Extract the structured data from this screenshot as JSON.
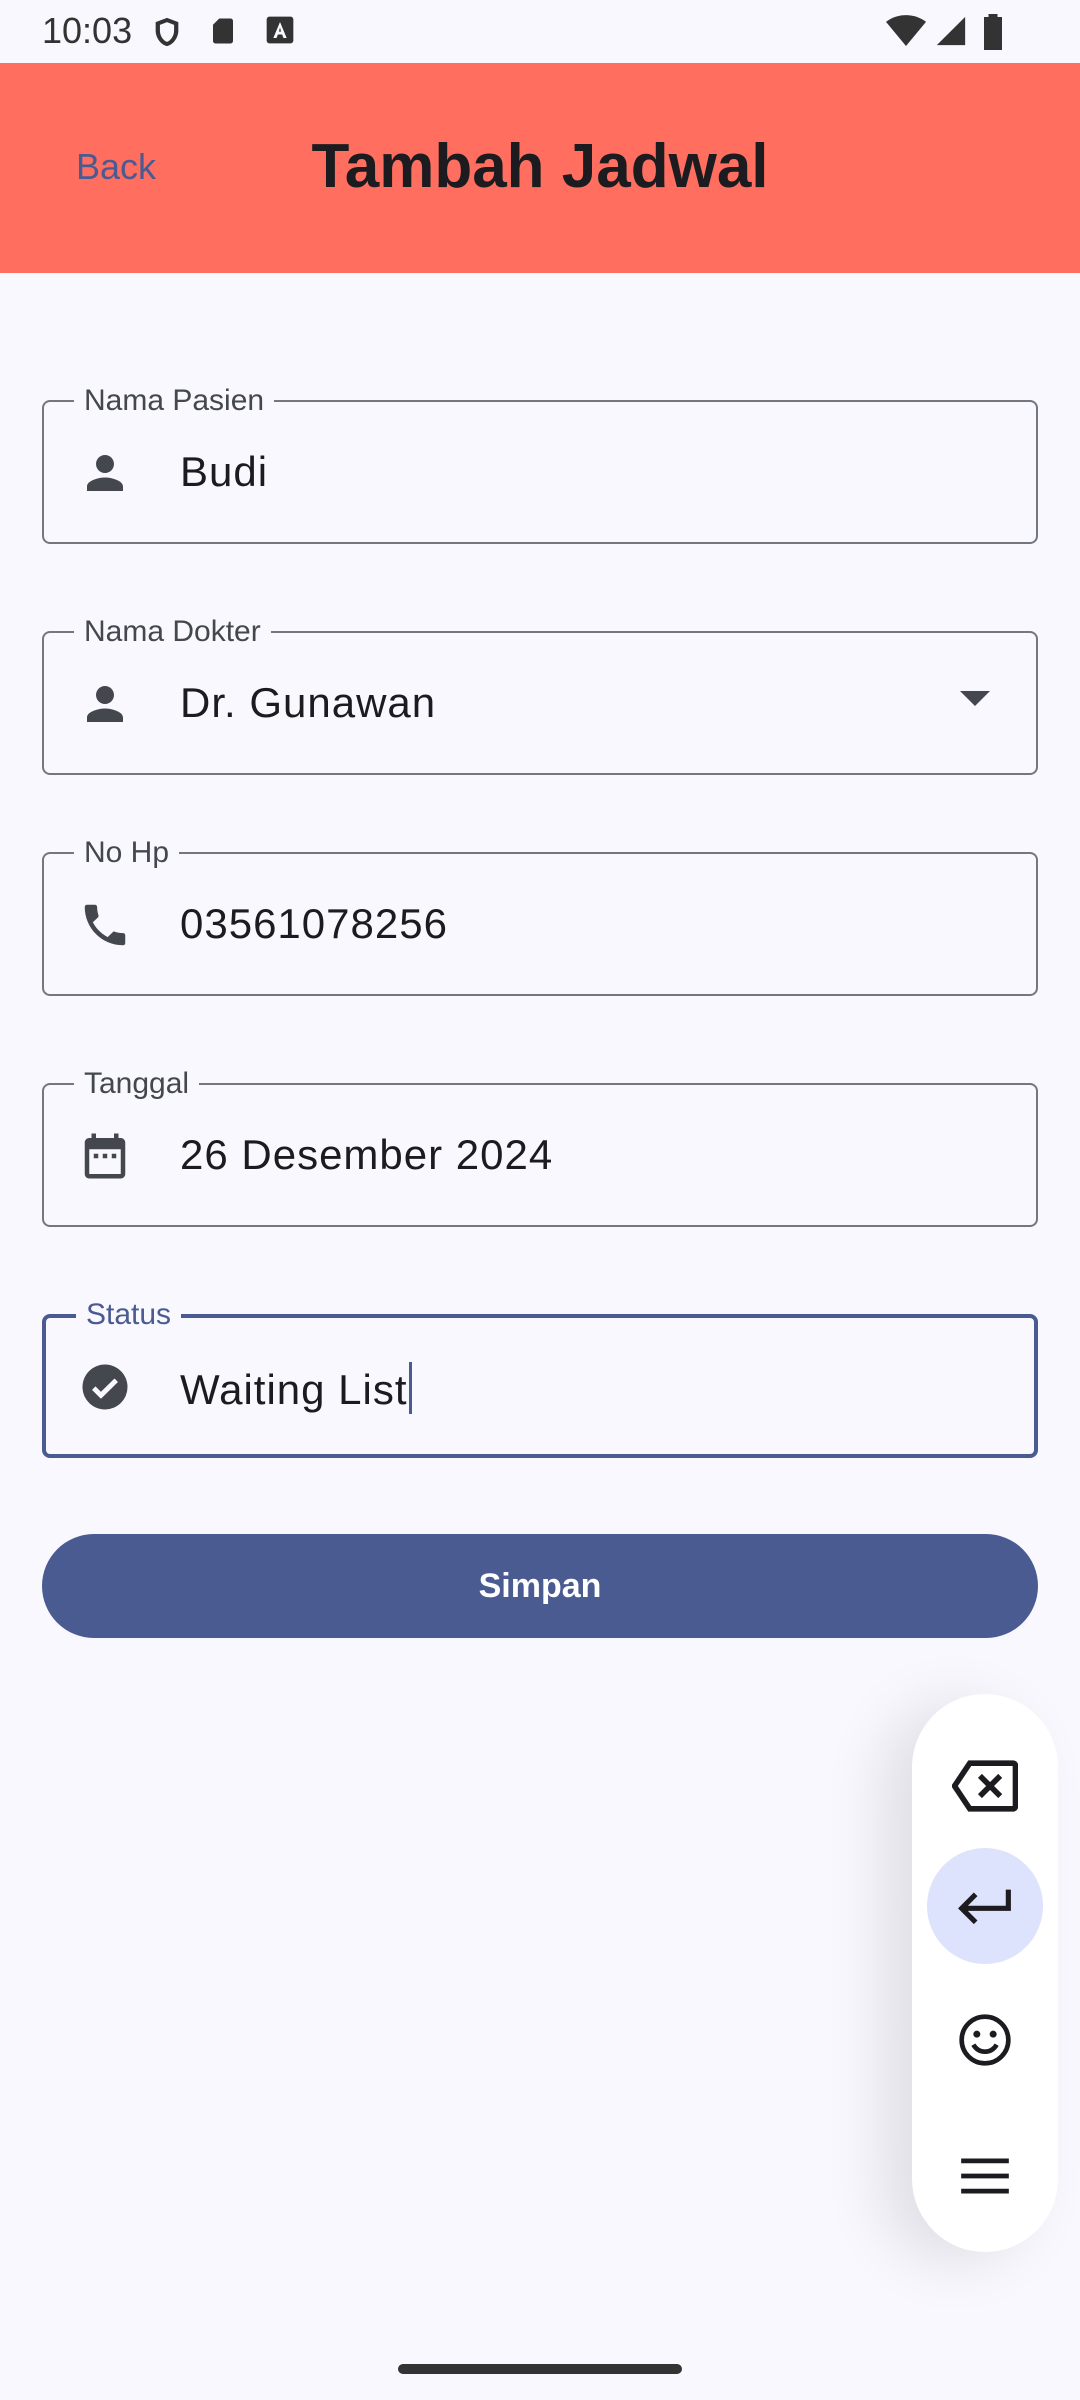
{
  "status_bar": {
    "time": "10:03"
  },
  "app_bar": {
    "back_label": "Back",
    "title": "Tambah Jadwal",
    "background_color": "#ff6e5f"
  },
  "form": {
    "nama_pasien": {
      "label": "Nama Pasien",
      "value": "Budi",
      "icon": "person-icon"
    },
    "nama_dokter": {
      "label": "Nama Dokter",
      "value": "Dr. Gunawan",
      "icon": "person-icon"
    },
    "no_hp": {
      "label": "No Hp",
      "value": "03561078256",
      "icon": "phone-icon"
    },
    "tanggal": {
      "label": "Tanggal",
      "value": "26 Desember 2024",
      "icon": "calendar-icon"
    },
    "status": {
      "label": "Status",
      "value": "Waiting List",
      "icon": "check-circle-icon"
    },
    "save_label": "Simpan",
    "accent_color": "#4a5b92"
  },
  "floating_keyboard": {
    "items": [
      "backspace-icon",
      "enter-icon",
      "emoji-icon",
      "menu-icon"
    ]
  }
}
